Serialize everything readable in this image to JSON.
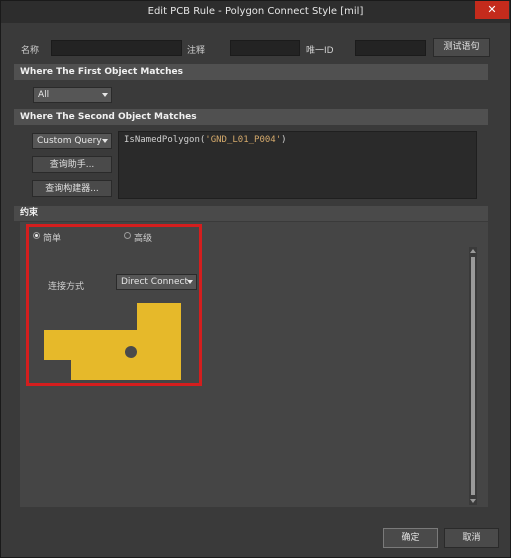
{
  "window": {
    "title": "Edit PCB Rule - Polygon Connect Style [mil]",
    "close_icon": "✕"
  },
  "rule_header": {
    "name_label": "名称",
    "comment_label": "注释",
    "uid_label": "唯一ID",
    "test_button": "测试语句",
    "name_value": "",
    "comment_value": "",
    "uid_value": ""
  },
  "first_match": {
    "header": "Where The First Object Matches",
    "scope_value": "All"
  },
  "second_match": {
    "header": "Where The Second Object Matches",
    "scope_value": "Custom Query",
    "query_helper_button": "查询助手...",
    "query_builder_button": "查询构建器...",
    "query_text_func": "IsNamedPolygon(",
    "query_text_arg": "'GND_L01_P004'",
    "query_text_close": ")"
  },
  "constraints": {
    "header": "约束",
    "simple_label": "简单",
    "advanced_label": "高级",
    "simple_selected": true,
    "connect_style_label": "连接方式",
    "connect_style_value": "Direct Connect",
    "preview_fill_color": "#e6b92a",
    "preview_hole_color": "#4a4a4a"
  },
  "footer": {
    "ok_button": "确定",
    "cancel_button": "取消"
  },
  "colors": {
    "highlight_box": "#d41e1e",
    "close_button": "#c42b1c"
  }
}
